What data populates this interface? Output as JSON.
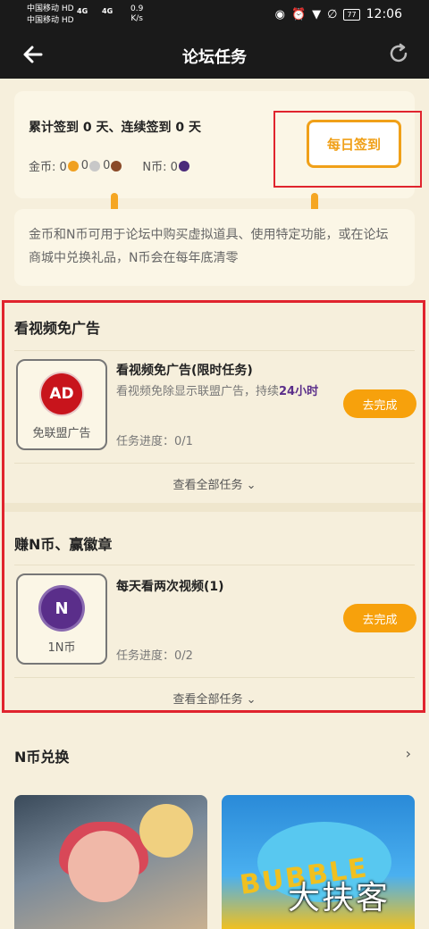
{
  "status_bar": {
    "carrier1": "中国移动 HD",
    "carrier2": "中国移动 HD",
    "network1": "4G",
    "network2": "4G",
    "speed": "0.9",
    "speed_unit": "K/s",
    "battery": "77",
    "time": "12:06"
  },
  "header": {
    "title": "论坛任务"
  },
  "sign_card": {
    "summary": "累计签到 0 天、连续签到 0 天",
    "gold_label": "金币: 0",
    "silver_value": "0",
    "bronze_value": "0",
    "n_label": "N币: 0",
    "sign_button": "每日签到"
  },
  "info": {
    "text": "金币和N币可用于论坛中购买虚拟道具、使用特定功能，或在论坛商城中兑换礼品，N币会在每年底清零"
  },
  "sections": [
    {
      "title": "看视频免广告",
      "task": {
        "icon_text": "AD",
        "icon_caption": "免联盟广告",
        "name": "看视频免广告(限时任务)",
        "desc_prefix": "看视频免除显示联盟广告，持续",
        "desc_highlight": "24小时",
        "progress": "任务进度：0/1",
        "button": "去完成"
      },
      "view_all": "查看全部任务"
    },
    {
      "title": "赚N币、赢徽章",
      "task": {
        "icon_text": "N",
        "icon_caption": "1N币",
        "name": "每天看两次视频(1)",
        "progress": "任务进度：0/2",
        "button": "去完成"
      },
      "view_all": "查看全部任务"
    }
  ],
  "exchange": {
    "title": "N币兑换",
    "thumb2_text": "BUBBLE",
    "watermark": "大扶客"
  },
  "colors": {
    "accent": "#f7a10c",
    "highlight_red": "#e0242e",
    "background": "#f6efdc",
    "n_purple": "#5a2e8a"
  }
}
